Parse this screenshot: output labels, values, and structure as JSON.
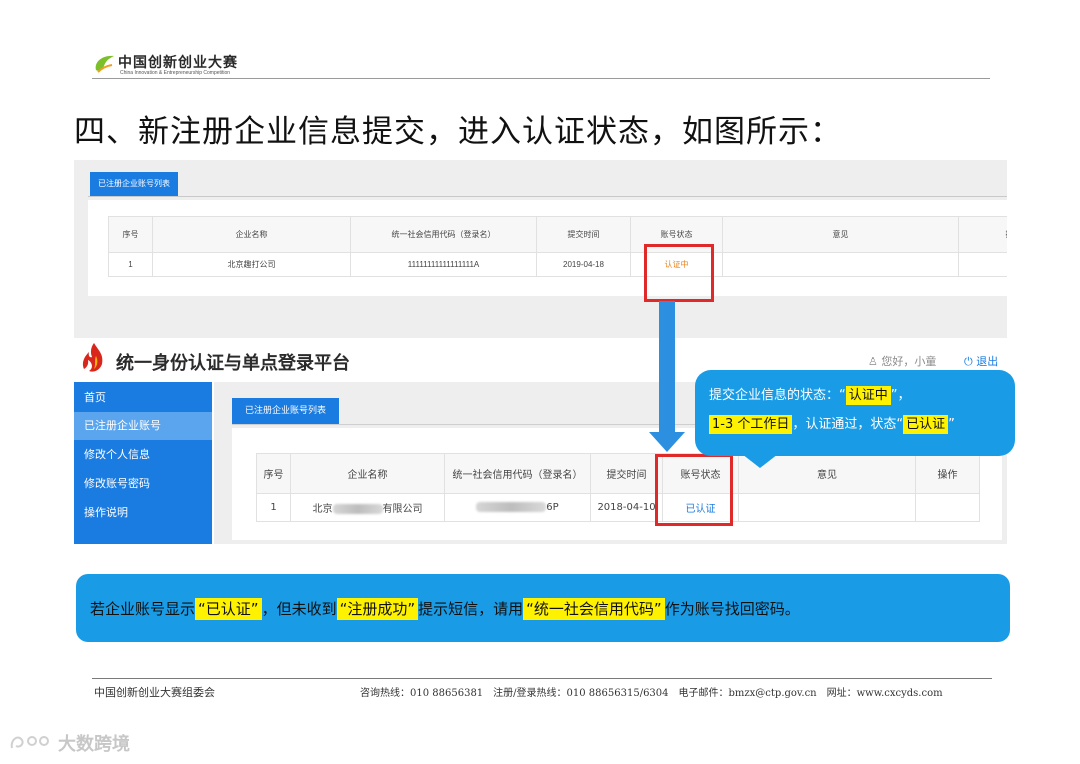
{
  "header": {
    "logo_cn": "中国创新创业大赛",
    "logo_en": "China Innovation & Entrepreneurship Competition",
    "title": "四、新注册企业信息提交，进入认证状态，如图所示："
  },
  "panel1": {
    "tab": "已注册企业账号列表",
    "columns": [
      "序号",
      "企业名称",
      "统一社会信用代码（登录名）",
      "提交时间",
      "账号状态",
      "意见",
      "操作"
    ],
    "row": {
      "index": "1",
      "company": "北京趣打公司",
      "credit_code": "11111111111111111A",
      "date": "2019-04-18",
      "status": "认证中",
      "status_color": "#e8841e"
    }
  },
  "panel2": {
    "platform_title": "统一身份认证与单点登录平台",
    "user_greeting": "您好，小童",
    "logout": "退出",
    "sidebar": [
      {
        "label": "首页",
        "active": false
      },
      {
        "label": "已注册企业账号",
        "active": true
      },
      {
        "label": "修改个人信息",
        "active": false
      },
      {
        "label": "修改账号密码",
        "active": false
      },
      {
        "label": "操作说明",
        "active": false
      }
    ],
    "tab": "已注册企业账号列表",
    "columns": [
      "序号",
      "企业名称",
      "统一社会信用代码（登录名）",
      "提交时间",
      "账号状态",
      "意见",
      "操作"
    ],
    "row": {
      "index": "1",
      "company_prefix": "北京",
      "company_suffix": "有限公司",
      "credit_code_suffix": "6P",
      "date": "2018-04-10",
      "status": "已认证",
      "status_color": "#1a7be0"
    }
  },
  "callout": {
    "line1_prefix": "提交企业信息的状态：“",
    "line1_highlight": "认证中",
    "line1_suffix": "”，",
    "line2_highlight": "1-3 个工作日",
    "line2_middle": "，认证通过，状态“",
    "line2_highlight2": "已认证",
    "line2_suffix": "”"
  },
  "notice": {
    "p1": "若企业账号显示",
    "h1": "“已认证”",
    "p2": "，但未收到",
    "h2": "“注册成功”",
    "p3": "提示短信，请用",
    "h3": "“统一社会信用代码”",
    "p4": "作为账号找回密码。"
  },
  "footer": {
    "org": "中国创新创业大赛组委会",
    "contact": "咨询热线：010 88656381　注册/登录热线：010 88656315/6304　电子邮件：bmzx@ctp.gov.cn　网址：www.cxcyds.com"
  },
  "watermark": "大数跨境",
  "colors": {
    "accent_blue": "#1a7be0",
    "callout_blue": "#1a9be6",
    "highlight_yellow": "#fff200",
    "red_box": "#e02a2a"
  }
}
